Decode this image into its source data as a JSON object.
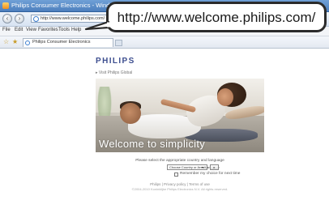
{
  "browser": {
    "window_title": "Philips Consumer Electronics - Windows Internet Explorer",
    "address_value": "http://www.welcome.philips.com/",
    "menu": [
      "File",
      "Edit",
      "View",
      "Favorites",
      "Tools",
      "Help"
    ],
    "tab_label": "Philips Consumer Electronics"
  },
  "callout": {
    "url": "http://www.welcome.philips.com/"
  },
  "page": {
    "brand": "PHILIPS",
    "visit_link": "▸ Visit Philips Global",
    "tagline": "Welcome to simplicity",
    "select_caption": "Please select the appropriate country and language",
    "country_select_value": "Choose Country or Area/Language",
    "go_label": "▸",
    "remember_label": "Remember my choice for next time",
    "footer_links": "Philips | Privacy policy | Terms of use",
    "copyright": "©2004-2010 Koninklijke Philips Electronics N.V. All rights reserved."
  },
  "colors": {
    "brand": "#3d4e8f",
    "titlebar": "#4d7fbd"
  },
  "icons": [
    "ie-logo-icon",
    "back-icon",
    "forward-icon",
    "favorites-star-icon",
    "add-favorites-icon",
    "new-tab-icon",
    "dropdown-arrow-icon"
  ]
}
